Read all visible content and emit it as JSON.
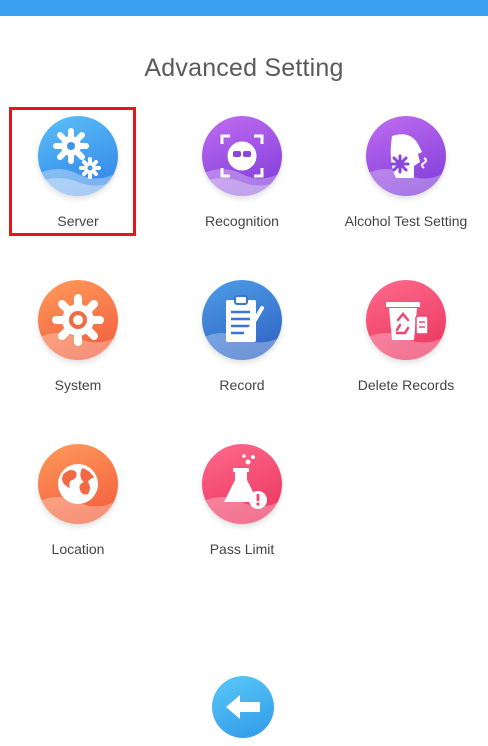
{
  "header": {
    "title": "Advanced Setting"
  },
  "tiles": [
    {
      "label": "Server"
    },
    {
      "label": "Recognition"
    },
    {
      "label": "Alcohol Test Setting"
    },
    {
      "label": "System"
    },
    {
      "label": "Record"
    },
    {
      "label": "Delete Records"
    },
    {
      "label": "Location"
    },
    {
      "label": "Pass Limit"
    }
  ],
  "icons": [
    "gears-icon",
    "face-scan-icon",
    "breath-test-icon",
    "gear-icon",
    "clipboard-icon",
    "recycle-bin-icon",
    "globe-icon",
    "flask-icon",
    "back-arrow-icon"
  ],
  "colors": {
    "topbar": "#3aa0f0",
    "highlight": "#e8141c"
  }
}
